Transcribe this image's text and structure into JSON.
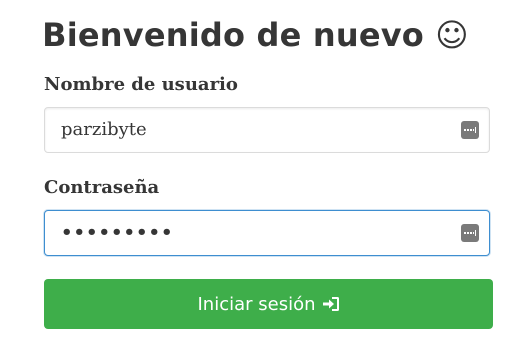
{
  "page": {
    "title": "Bienvenido de nuevo ☺"
  },
  "form": {
    "username_label": "Nombre de usuario",
    "username_value": "parzibyte",
    "password_label": "Contraseña",
    "password_value": "•••••••••",
    "submit_label": "Iniciar sesión"
  },
  "icons": {
    "username_field_icon": "password-manager-key-icon",
    "password_field_icon": "password-manager-key-icon",
    "submit_icon": "sign-in-icon"
  },
  "colors": {
    "submit_button": "#3eae4a",
    "focus_border": "#3e8ed0",
    "text": "#363636"
  }
}
